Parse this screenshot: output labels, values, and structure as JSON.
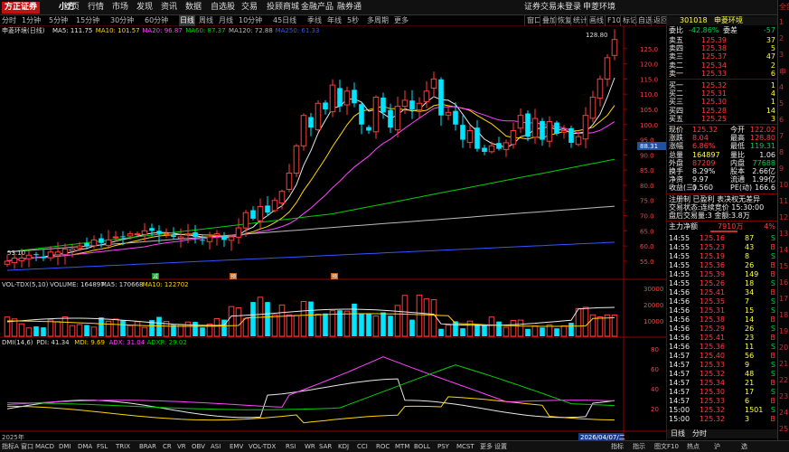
{
  "menubar": {
    "logo": "方正证券",
    "logo2": "小方",
    "items": [
      "首页",
      "行情",
      "市场",
      "发现",
      "资讯",
      "数据",
      "自选股",
      "交易",
      "投顾商城",
      "金融产品",
      "融券通"
    ],
    "right": [
      "证券交易未登录",
      "申菱环境"
    ]
  },
  "periods": [
    "分时",
    "1分钟",
    "5分钟",
    "15分钟",
    "30分钟",
    "60分钟",
    "日线",
    "周线",
    "月线",
    "10分钟",
    "45日线",
    "季线",
    "年线",
    "5秒",
    "多周期",
    "更多"
  ],
  "periods_selected": "日线",
  "topbuttons": [
    "窗口",
    "叠加",
    "恢复",
    "统计",
    "画线",
    "F10",
    "标记",
    "自选",
    "返回"
  ],
  "stock": {
    "code": "301018",
    "name": "申菱环境",
    "full_name": "申菱环境(日线)",
    "ma_legend": [
      {
        "label": "MA5: 111.75",
        "color": "#e8e8e8"
      },
      {
        "label": "MA10: 101.57",
        "color": "#ffd700"
      },
      {
        "label": "MA20: 96.87",
        "color": "#ff44ff"
      },
      {
        "label": "MA60: 87.37",
        "color": "#00d000"
      },
      {
        "label": "MA120: 72.88",
        "color": "#bbbbbb"
      },
      {
        "label": "MA250: 61.33",
        "color": "#3355ff"
      }
    ],
    "high_label": "128.80",
    "low_label": "53.10",
    "current_tag": "88.31"
  },
  "chart_data": {
    "type": "candlestick",
    "price_ticks": [
      "125.0",
      "120.0",
      "115.0",
      "110.0",
      "105.0",
      "100.0",
      "95.0",
      "90.0",
      "85.0",
      "80.0",
      "75.0",
      "70.0",
      "65.0",
      "60.0",
      "55.0"
    ],
    "volume_ticks": [
      "30000",
      "20000",
      "10000"
    ],
    "dmi_ticks": [
      "80",
      "60",
      "40",
      "20"
    ],
    "closes": [
      55,
      56,
      56,
      57,
      57,
      56,
      58,
      58,
      59,
      59,
      60,
      60,
      62,
      61,
      62,
      63,
      63,
      64,
      64,
      65,
      65,
      64,
      64,
      63,
      63,
      64,
      63,
      62,
      63,
      64,
      62,
      63,
      66,
      71,
      69,
      73,
      71,
      75,
      78,
      84,
      93,
      103,
      99,
      107,
      105,
      113,
      106,
      111,
      107,
      100,
      98,
      109,
      104,
      99,
      106,
      108,
      105,
      107,
      111,
      115,
      103,
      104,
      100,
      95,
      98,
      92,
      91,
      93,
      92,
      94,
      98,
      103,
      96,
      102,
      95,
      101,
      97,
      98,
      94,
      96,
      103,
      109,
      115,
      122,
      128
    ],
    "vol_legend": [
      {
        "label": "VOL-TDX(5,10)",
        "color": "#dddddd"
      },
      {
        "label": "VOLUME: 164897",
        "color": "#dddddd"
      },
      {
        "label": "MA5: 170668",
        "color": "#dddddd"
      },
      {
        "label": "MA10: 122702",
        "color": "#ffd700"
      }
    ],
    "dmi_legend": [
      {
        "label": "DMI(14,6)",
        "color": "#dddddd"
      },
      {
        "label": "PDI: 41.34",
        "color": "#dddddd"
      },
      {
        "label": "MDI: 9.69",
        "color": "#ffd700"
      },
      {
        "label": "ADX: 31.04",
        "color": "#ff44ff"
      },
      {
        "label": "ADXR: 29.02",
        "color": "#00d000"
      }
    ],
    "date_left": "2025年",
    "date_right": "2026/04/07/二",
    "markers": [
      "减",
      "预",
      "预"
    ]
  },
  "quote": {
    "ratio_label": "委比",
    "ratio_value": "-42.86%",
    "diff_label": "委差",
    "diff_value": "-57",
    "sells": [
      {
        "label": "卖五",
        "price": "125.39",
        "vol": "37"
      },
      {
        "label": "卖四",
        "price": "125.38",
        "vol": "5"
      },
      {
        "label": "卖三",
        "price": "125.37",
        "vol": "47"
      },
      {
        "label": "卖二",
        "price": "125.34",
        "vol": "2"
      },
      {
        "label": "卖一",
        "price": "125.33",
        "vol": "6"
      }
    ],
    "buys": [
      {
        "label": "买一",
        "price": "125.32",
        "vol": "1"
      },
      {
        "label": "买二",
        "price": "125.31",
        "vol": "4"
      },
      {
        "label": "买三",
        "price": "125.30",
        "vol": "1"
      },
      {
        "label": "买四",
        "price": "125.28",
        "vol": "14"
      },
      {
        "label": "买五",
        "price": "125.25",
        "vol": "3"
      }
    ],
    "stats": [
      {
        "l1": "现价",
        "v1": "125.32",
        "l2": "今开",
        "v2": "122.02"
      },
      {
        "l1": "涨跌",
        "v1": "8.04",
        "l2": "最高",
        "v2": "128.80"
      },
      {
        "l1": "涨幅",
        "v1": "6.86%",
        "l2": "最低",
        "v2": "119.31"
      },
      {
        "l1": "总量",
        "v1": "164897",
        "l2": "量比",
        "v2": "1.06"
      },
      {
        "l1": "外盘",
        "v1": "87209",
        "l2": "内盘",
        "v2": "77688"
      },
      {
        "l1": "换手",
        "v1": "8.29%",
        "l2": "股本",
        "v2": "2.66亿"
      },
      {
        "l1": "净资",
        "v1": "9.97",
        "l2": "流通",
        "v2": "1.99亿"
      },
      {
        "l1": "收益(三)",
        "v1": "0.560",
        "l2": "PE(动)",
        "v2": "166.6"
      }
    ],
    "notes": [
      "注册制 已盈利 表决权无差异",
      "交易状态:连续竞价 15:30:00",
      "盘后交易量:3 金额:3.8万"
    ],
    "flow_label": "主力净额",
    "flow_value": "7910万",
    "flow_pct": "4%",
    "ticks": [
      {
        "t": "14:55",
        "p": "125.16",
        "v": "87",
        "b": "S"
      },
      {
        "t": "14:55",
        "p": "125.23",
        "v": "43",
        "b": "B"
      },
      {
        "t": "14:55",
        "p": "125.19",
        "v": "8",
        "b": "S"
      },
      {
        "t": "14:55",
        "p": "125.36",
        "v": "26",
        "b": "B"
      },
      {
        "t": "14:55",
        "p": "125.39",
        "v": "149",
        "b": "B"
      },
      {
        "t": "14:55",
        "p": "125.26",
        "v": "18",
        "b": "S"
      },
      {
        "t": "14:56",
        "p": "125.41",
        "v": "34",
        "b": "B"
      },
      {
        "t": "14:56",
        "p": "125.35",
        "v": "7",
        "b": "S"
      },
      {
        "t": "14:56",
        "p": "125.31",
        "v": "15",
        "b": "S"
      },
      {
        "t": "14:56",
        "p": "125.38",
        "v": "14",
        "b": "B"
      },
      {
        "t": "14:56",
        "p": "125.29",
        "v": "26",
        "b": "S"
      },
      {
        "t": "14:56",
        "p": "125.41",
        "v": "23",
        "b": "B"
      },
      {
        "t": "14:56",
        "p": "125.36",
        "v": "11",
        "b": "S"
      },
      {
        "t": "14:57",
        "p": "125.40",
        "v": "56",
        "b": "B"
      },
      {
        "t": "14:57",
        "p": "125.33",
        "v": "9",
        "b": "S"
      },
      {
        "t": "14:57",
        "p": "125.32",
        "v": "48",
        "b": "S"
      },
      {
        "t": "14:57",
        "p": "125.34",
        "v": "21",
        "b": "B"
      },
      {
        "t": "14:57",
        "p": "125.30",
        "v": "17",
        "b": "S"
      },
      {
        "t": "14:57",
        "p": "125.33",
        "v": "6",
        "b": "B"
      },
      {
        "t": "15:00",
        "p": "125.32",
        "v": "1501",
        "b": "S"
      },
      {
        "t": "15:00",
        "p": "125.32",
        "v": "3",
        "b": "B"
      }
    ],
    "tabs": [
      "日线",
      "分时"
    ]
  },
  "farright": [
    "全部",
    "1",
    "2",
    "3",
    "申",
    "4",
    "5",
    "6",
    "7",
    "8",
    "9",
    "10",
    "11",
    "12",
    "13",
    "14",
    "15",
    "16",
    "17",
    "18",
    "19",
    "20",
    "21",
    "22",
    "23",
    "24",
    "25"
  ],
  "bottombar": {
    "tabs": [
      "指标A",
      "窗口",
      "MACD",
      "DMI",
      "DMA",
      "FSL",
      "TRIX",
      "BRAR",
      "CR",
      "VR",
      "OBV",
      "ASI",
      "EMV",
      "VOL-TDX",
      "RSI",
      "WR",
      "SAR",
      "KDJ",
      "CCI",
      "ROC",
      "MTM",
      "BOLL",
      "PSY",
      "MCST",
      "更多",
      "设置"
    ],
    "left": [
      "扩展人",
      "沪深指标",
      "综合选股",
      "翻转选股"
    ],
    "right": [
      "指标",
      "指示",
      "图文F10",
      "热点",
      "沪",
      "选"
    ]
  }
}
